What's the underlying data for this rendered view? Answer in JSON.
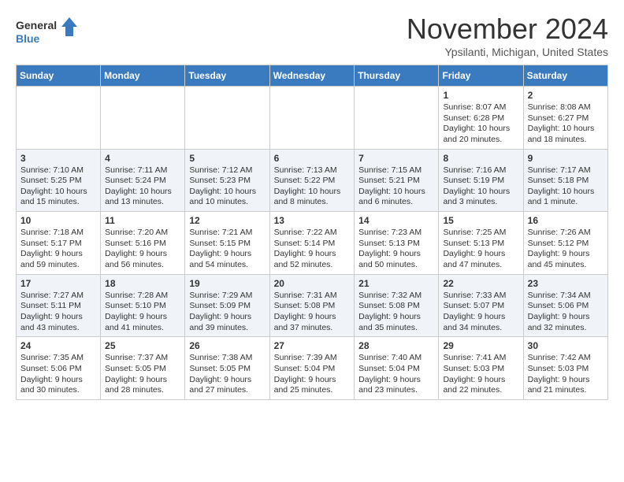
{
  "header": {
    "logo_line1": "General",
    "logo_line2": "Blue",
    "month_title": "November 2024",
    "location": "Ypsilanti, Michigan, United States"
  },
  "weekdays": [
    "Sunday",
    "Monday",
    "Tuesday",
    "Wednesday",
    "Thursday",
    "Friday",
    "Saturday"
  ],
  "weeks": [
    [
      {
        "day": "",
        "info": ""
      },
      {
        "day": "",
        "info": ""
      },
      {
        "day": "",
        "info": ""
      },
      {
        "day": "",
        "info": ""
      },
      {
        "day": "",
        "info": ""
      },
      {
        "day": "1",
        "info": "Sunrise: 8:07 AM\nSunset: 6:28 PM\nDaylight: 10 hours and 20 minutes."
      },
      {
        "day": "2",
        "info": "Sunrise: 8:08 AM\nSunset: 6:27 PM\nDaylight: 10 hours and 18 minutes."
      }
    ],
    [
      {
        "day": "3",
        "info": "Sunrise: 7:10 AM\nSunset: 5:25 PM\nDaylight: 10 hours and 15 minutes."
      },
      {
        "day": "4",
        "info": "Sunrise: 7:11 AM\nSunset: 5:24 PM\nDaylight: 10 hours and 13 minutes."
      },
      {
        "day": "5",
        "info": "Sunrise: 7:12 AM\nSunset: 5:23 PM\nDaylight: 10 hours and 10 minutes."
      },
      {
        "day": "6",
        "info": "Sunrise: 7:13 AM\nSunset: 5:22 PM\nDaylight: 10 hours and 8 minutes."
      },
      {
        "day": "7",
        "info": "Sunrise: 7:15 AM\nSunset: 5:21 PM\nDaylight: 10 hours and 6 minutes."
      },
      {
        "day": "8",
        "info": "Sunrise: 7:16 AM\nSunset: 5:19 PM\nDaylight: 10 hours and 3 minutes."
      },
      {
        "day": "9",
        "info": "Sunrise: 7:17 AM\nSunset: 5:18 PM\nDaylight: 10 hours and 1 minute."
      }
    ],
    [
      {
        "day": "10",
        "info": "Sunrise: 7:18 AM\nSunset: 5:17 PM\nDaylight: 9 hours and 59 minutes."
      },
      {
        "day": "11",
        "info": "Sunrise: 7:20 AM\nSunset: 5:16 PM\nDaylight: 9 hours and 56 minutes."
      },
      {
        "day": "12",
        "info": "Sunrise: 7:21 AM\nSunset: 5:15 PM\nDaylight: 9 hours and 54 minutes."
      },
      {
        "day": "13",
        "info": "Sunrise: 7:22 AM\nSunset: 5:14 PM\nDaylight: 9 hours and 52 minutes."
      },
      {
        "day": "14",
        "info": "Sunrise: 7:23 AM\nSunset: 5:13 PM\nDaylight: 9 hours and 50 minutes."
      },
      {
        "day": "15",
        "info": "Sunrise: 7:25 AM\nSunset: 5:13 PM\nDaylight: 9 hours and 47 minutes."
      },
      {
        "day": "16",
        "info": "Sunrise: 7:26 AM\nSunset: 5:12 PM\nDaylight: 9 hours and 45 minutes."
      }
    ],
    [
      {
        "day": "17",
        "info": "Sunrise: 7:27 AM\nSunset: 5:11 PM\nDaylight: 9 hours and 43 minutes."
      },
      {
        "day": "18",
        "info": "Sunrise: 7:28 AM\nSunset: 5:10 PM\nDaylight: 9 hours and 41 minutes."
      },
      {
        "day": "19",
        "info": "Sunrise: 7:29 AM\nSunset: 5:09 PM\nDaylight: 9 hours and 39 minutes."
      },
      {
        "day": "20",
        "info": "Sunrise: 7:31 AM\nSunset: 5:08 PM\nDaylight: 9 hours and 37 minutes."
      },
      {
        "day": "21",
        "info": "Sunrise: 7:32 AM\nSunset: 5:08 PM\nDaylight: 9 hours and 35 minutes."
      },
      {
        "day": "22",
        "info": "Sunrise: 7:33 AM\nSunset: 5:07 PM\nDaylight: 9 hours and 34 minutes."
      },
      {
        "day": "23",
        "info": "Sunrise: 7:34 AM\nSunset: 5:06 PM\nDaylight: 9 hours and 32 minutes."
      }
    ],
    [
      {
        "day": "24",
        "info": "Sunrise: 7:35 AM\nSunset: 5:06 PM\nDaylight: 9 hours and 30 minutes."
      },
      {
        "day": "25",
        "info": "Sunrise: 7:37 AM\nSunset: 5:05 PM\nDaylight: 9 hours and 28 minutes."
      },
      {
        "day": "26",
        "info": "Sunrise: 7:38 AM\nSunset: 5:05 PM\nDaylight: 9 hours and 27 minutes."
      },
      {
        "day": "27",
        "info": "Sunrise: 7:39 AM\nSunset: 5:04 PM\nDaylight: 9 hours and 25 minutes."
      },
      {
        "day": "28",
        "info": "Sunrise: 7:40 AM\nSunset: 5:04 PM\nDaylight: 9 hours and 23 minutes."
      },
      {
        "day": "29",
        "info": "Sunrise: 7:41 AM\nSunset: 5:03 PM\nDaylight: 9 hours and 22 minutes."
      },
      {
        "day": "30",
        "info": "Sunrise: 7:42 AM\nSunset: 5:03 PM\nDaylight: 9 hours and 21 minutes."
      }
    ]
  ]
}
